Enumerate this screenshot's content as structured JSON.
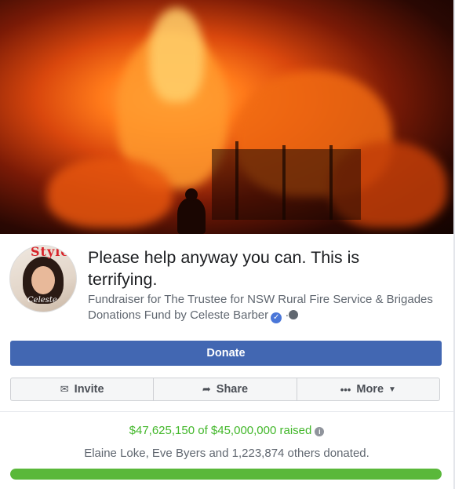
{
  "fundraiser": {
    "title": "Please help anyway you can. This is terrifying.",
    "subtitle": "Fundraiser for The Trustee for NSW Rural Fire Service & Brigades Donations Fund by Celeste Barber",
    "separator": "·"
  },
  "avatar": {
    "magazine_text": "Style",
    "signature_text": "Celeste"
  },
  "buttons": {
    "donate": "Donate",
    "invite": "Invite",
    "share": "Share",
    "more": "More"
  },
  "stats": {
    "raised_text": "$47,625,150 of $45,000,000 raised",
    "donors_text": "Elaine Loke, Eve Byers and 1,223,874 others donated.",
    "progress_fraction": 1.0
  },
  "icons": {
    "cover": "wildfire-photo",
    "verified": "verified-badge-icon",
    "privacy": "globe-icon",
    "invite": "envelope-icon",
    "share": "share-arrow-icon",
    "more": "ellipsis-icon",
    "info": "info-icon"
  },
  "colors": {
    "donate_bg": "#4267b2",
    "raised_green": "#42b72a",
    "progress_green": "#5ab83a"
  }
}
